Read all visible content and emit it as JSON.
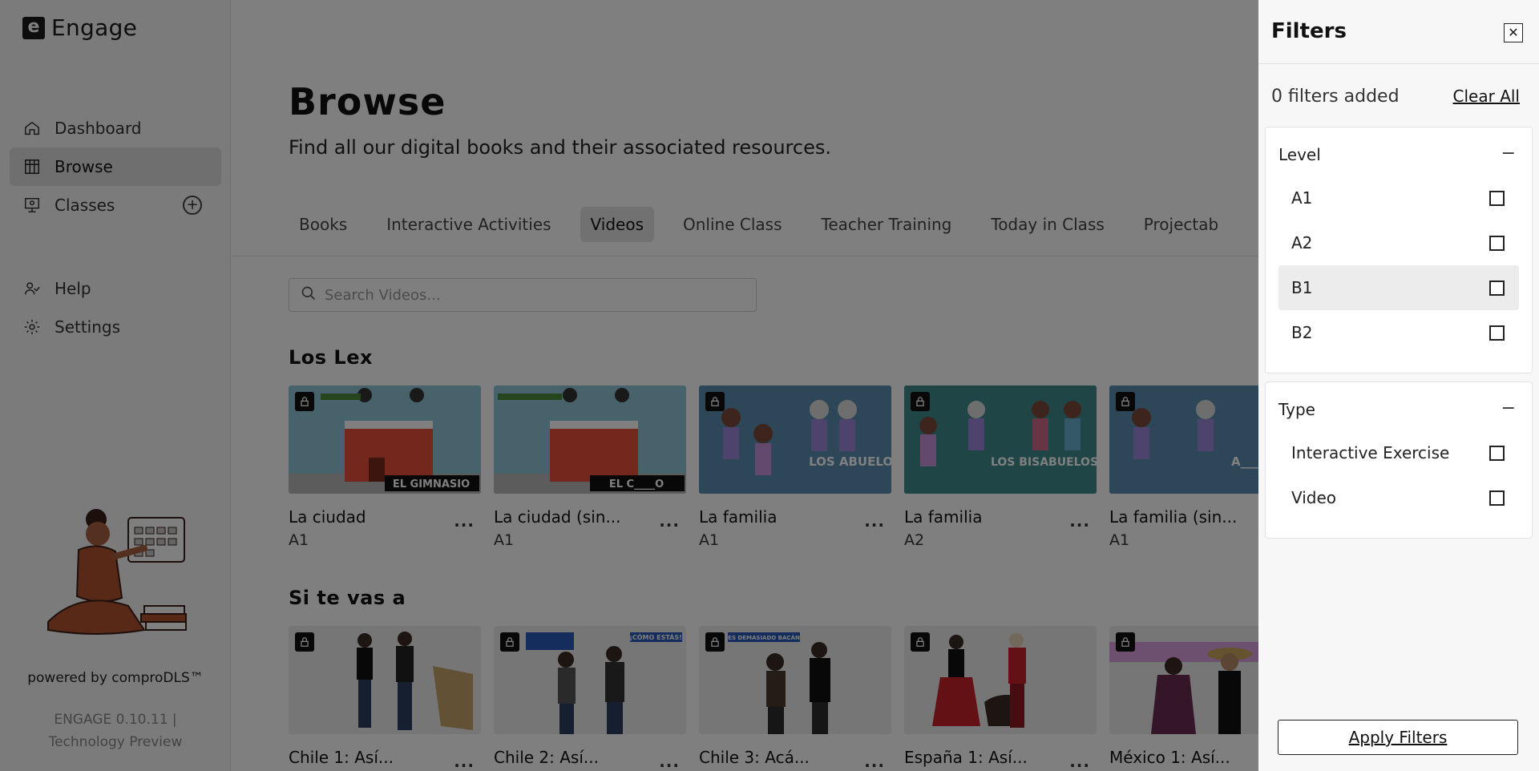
{
  "brand": {
    "logo_letter": "e",
    "name": "Engage"
  },
  "nav": {
    "primary": [
      {
        "label": "Dashboard",
        "icon": "home-icon"
      },
      {
        "label": "Browse",
        "icon": "grid-icon"
      },
      {
        "label": "Classes",
        "icon": "classroom-icon"
      }
    ],
    "secondary": [
      {
        "label": "Help",
        "icon": "help-icon"
      },
      {
        "label": "Settings",
        "icon": "gear-icon"
      }
    ]
  },
  "footer": {
    "powered_by": "powered by comproDLS™",
    "version": "ENGAGE 0.10.11 |",
    "version_note": "Technology Preview"
  },
  "page": {
    "title": "Browse",
    "subtitle": "Find all our digital books and their associated resources."
  },
  "tabs": [
    "Books",
    "Interactive Activities",
    "Videos",
    "Online Class",
    "Teacher Training",
    "Today in Class",
    "Projectab"
  ],
  "active_tab": "Videos",
  "search": {
    "placeholder": "Search Videos..."
  },
  "sections": [
    {
      "title": "Los Lex",
      "items": [
        {
          "title": "La ciudad",
          "level": "A1",
          "caption": "EL GIMNASIO",
          "bg": "#8ec5d6"
        },
        {
          "title": "La ciudad (sin...",
          "level": "A1",
          "caption": "EL C____O",
          "bg": "#8ec5d6"
        },
        {
          "title": "La familia",
          "level": "A1",
          "caption": "LOS ABUELOS",
          "bg": "#2a6f7d"
        },
        {
          "title": "La familia",
          "level": "A2",
          "caption": "LOS BISABUELOS",
          "bg": "#2a6f7d"
        },
        {
          "title": "La familia (sin...",
          "level": "A1",
          "caption": "A___LO",
          "bg": "#2a6f7d"
        }
      ]
    },
    {
      "title": "Si te vas a",
      "items": [
        {
          "title": "Chile 1: Así...",
          "caption": "",
          "bg": "#ececec"
        },
        {
          "title": "Chile 2: Así...",
          "caption": "¡CÓMO ESTÁS!",
          "bg": "#ececec"
        },
        {
          "title": "Chile 3: Acá...",
          "caption": "ES DEMASIADO BACÁN",
          "bg": "#ececec"
        },
        {
          "title": "España 1: Así...",
          "caption": "",
          "bg": "#ececec"
        },
        {
          "title": "México 1: Así...",
          "caption": "",
          "bg": "#ececec"
        }
      ]
    }
  ],
  "filters": {
    "title": "Filters",
    "count_text": "0 filters added",
    "clear_all": "Clear All",
    "groups": [
      {
        "title": "Level",
        "toggle": "−",
        "options": [
          "A1",
          "A2",
          "B1",
          "B2"
        ]
      },
      {
        "title": "Type",
        "toggle": "−",
        "options": [
          "Interactive Exercise",
          "Video"
        ]
      }
    ],
    "apply": "Apply Filters"
  }
}
